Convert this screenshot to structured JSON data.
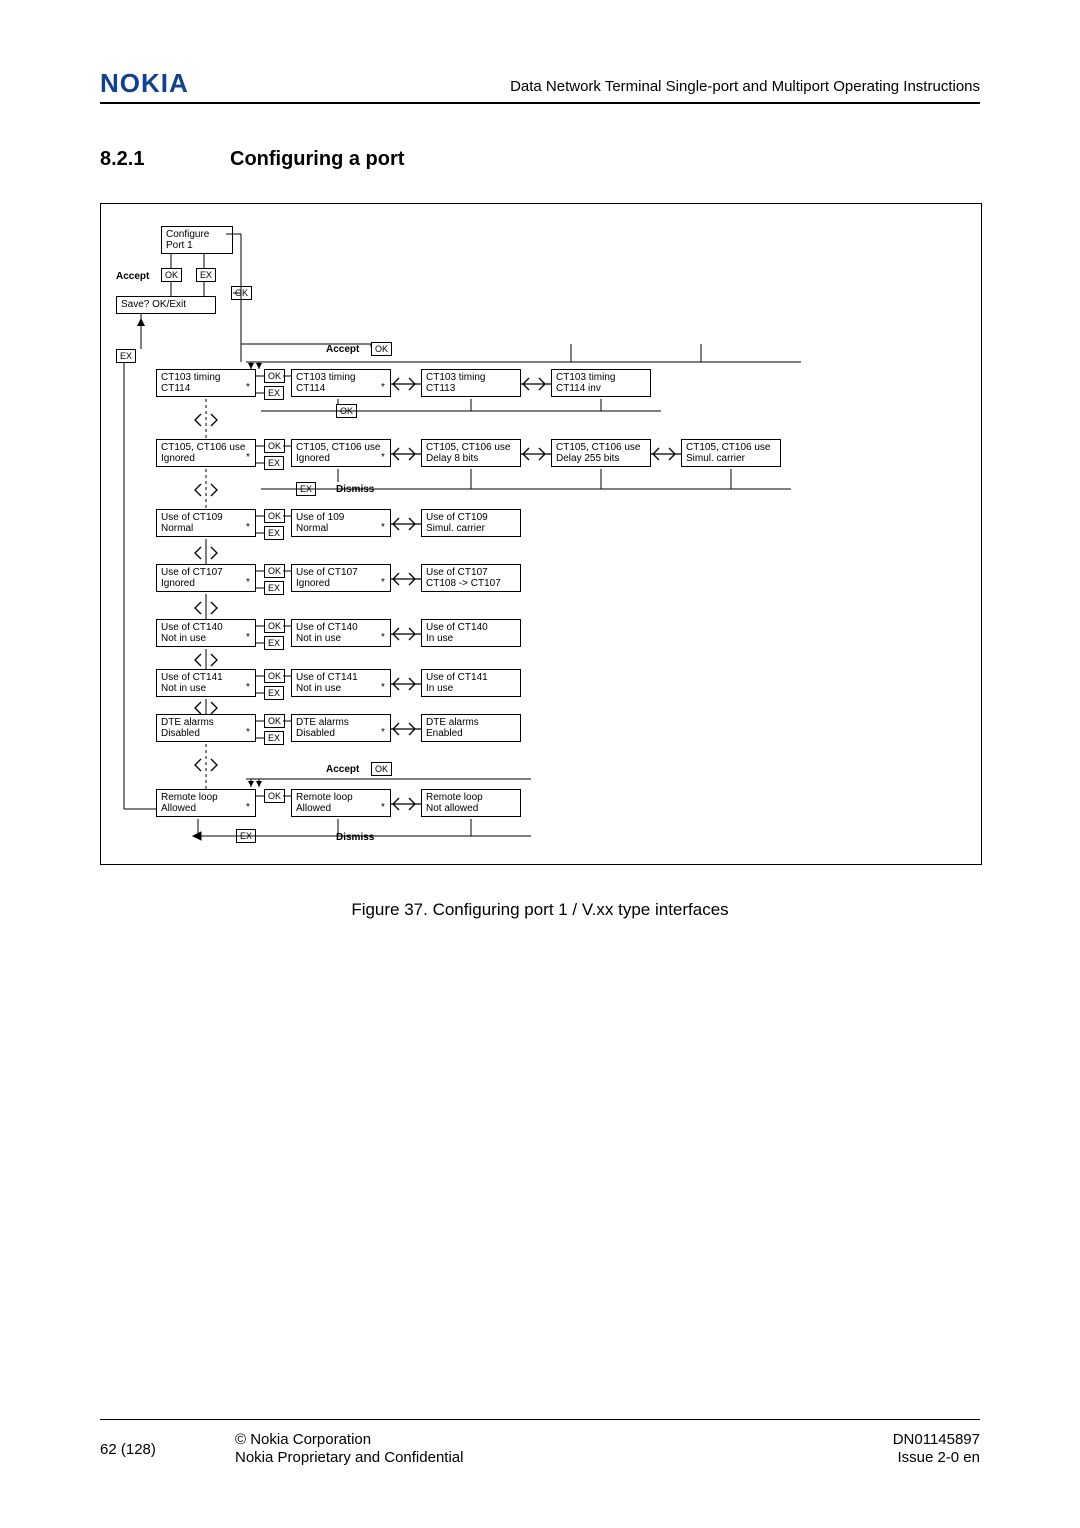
{
  "header": {
    "logo": "NOKIA",
    "title": "Data Network Terminal Single-port and Multiport Operating Instructions"
  },
  "section": {
    "number": "8.2.1",
    "title": "Configuring a port"
  },
  "caption": "Figure 37.    Configuring port 1 / V.xx type interfaces",
  "footer": {
    "page": "62 (128)",
    "mid1": "© Nokia Corporation",
    "mid2": "Nokia Proprietary and Confidential",
    "r1": "DN01145897",
    "r2": "Issue 2-0 en"
  },
  "d": {
    "cfg1": "Configure",
    "cfg2": "Port 1",
    "accept": "Accept",
    "dismiss": "Dismiss",
    "ok": "OK",
    "ex": "EX",
    "save": "Save? OK/Exit",
    "r1a1": "CT103 timing",
    "r1a2": "CT114",
    "r1b1": "CT103 timing",
    "r1b2": "CT114",
    "r1c1": "CT103 timing",
    "r1c2": "CT113",
    "r1d1": "CT103 timing",
    "r1d2": "CT114 inv",
    "r2a1": "CT105, CT106 use",
    "r2a2": "Ignored",
    "r2b1": "CT105, CT106 use",
    "r2b2": "Ignored",
    "r2c1": "CT105, CT106 use",
    "r2c2": "Delay 8 bits",
    "r2d1": "CT105, CT106 use",
    "r2d2": "Delay 255 bits",
    "r2e1": "CT105, CT106 use",
    "r2e2": "Simul. carrier",
    "r3a1": "Use of CT109",
    "r3a2": "Normal",
    "r3b1": "Use of 109",
    "r3b2": "Normal",
    "r3c1": "Use of CT109",
    "r3c2": "Simul. carrier",
    "r4a1": "Use of CT107",
    "r4a2": "Ignored",
    "r4b1": "Use of CT107",
    "r4b2": "Ignored",
    "r4c1": "Use of CT107",
    "r4c2": "CT108 -> CT107",
    "r5a1": "Use of CT140",
    "r5a2": "Not in use",
    "r5b1": "Use of CT140",
    "r5b2": "Not in use",
    "r5c1": "Use of CT140",
    "r5c2": "In use",
    "r6a1": "Use of CT141",
    "r6a2": "Not in use",
    "r6b1": "Use of CT141",
    "r6b2": "Not in use",
    "r6c1": "Use of CT141",
    "r6c2": "In use",
    "r7a1": "DTE alarms",
    "r7a2": "Disabled",
    "r7b1": "DTE alarms",
    "r7b2": "Disabled",
    "r7c1": "DTE alarms",
    "r7c2": "Enabled",
    "r8a1": "Remote loop",
    "r8a2": "Allowed",
    "r8b1": "Remote loop",
    "r8b2": "Allowed",
    "r8c1": "Remote loop",
    "r8c2": "Not allowed"
  }
}
